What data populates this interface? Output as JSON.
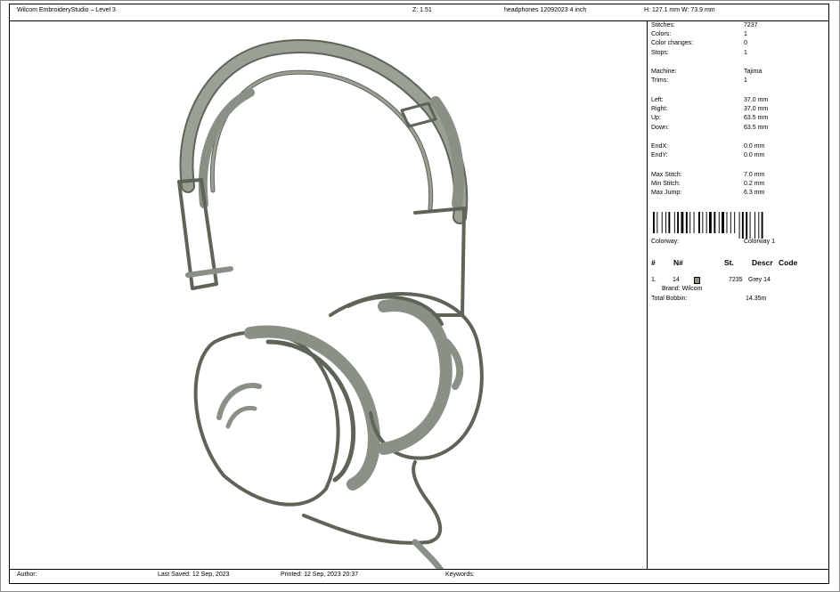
{
  "header": {
    "app": "Wilcom EmbroideryStudio – Level 3",
    "zoom": "Z: 1.51",
    "design_name": "headphones 12092023 4 inch",
    "dimensions": "H: 127.1 mm   W: 73.9 mm"
  },
  "info": {
    "rows": [
      {
        "k": "Stitches:",
        "v": "7237"
      },
      {
        "k": "Colors:",
        "v": "1"
      },
      {
        "k": "Color changes:",
        "v": "0"
      },
      {
        "k": "Stops:",
        "v": "1"
      },
      {
        "k": "Machine:",
        "v": "Tajima"
      },
      {
        "k": "Trims:",
        "v": "1"
      },
      {
        "k": "Left:",
        "v": "37.0 mm"
      },
      {
        "k": "Right:",
        "v": "37.0 mm"
      },
      {
        "k": "Up:",
        "v": "63.5 mm"
      },
      {
        "k": "Down:",
        "v": "63.5 mm"
      },
      {
        "k": "EndX:",
        "v": "0.0 mm"
      },
      {
        "k": "EndY:",
        "v": "0.0 mm"
      },
      {
        "k": "Max Stitch:",
        "v": "7.0 mm"
      },
      {
        "k": "Min Stitch:",
        "v": "0.2 mm"
      },
      {
        "k": "Max Jump:",
        "v": "6.3 mm"
      }
    ],
    "colorway_label": "Colorway:",
    "colorway_value": "Colorway 1"
  },
  "color_table": {
    "headers": {
      "num": "#",
      "n": "N#",
      "st": "St.",
      "descr": "Descr",
      "code": "Code"
    },
    "row": {
      "idx": "1.",
      "n": "14",
      "st": "7235",
      "descr": "Grey 14",
      "brand": "Brand: Wilcom",
      "swatch": "#8a8f86"
    },
    "total_bobbin_label": "Total Bobbin:",
    "total_bobbin_value": "14.35m"
  },
  "footer": {
    "author": "Author:",
    "last_saved": "Last Saved: 12 Sep, 2023",
    "printed": "Printed: 12 Sep, 2023 20:37",
    "keywords": "Keywords:"
  },
  "thread_color": "#8a9085"
}
